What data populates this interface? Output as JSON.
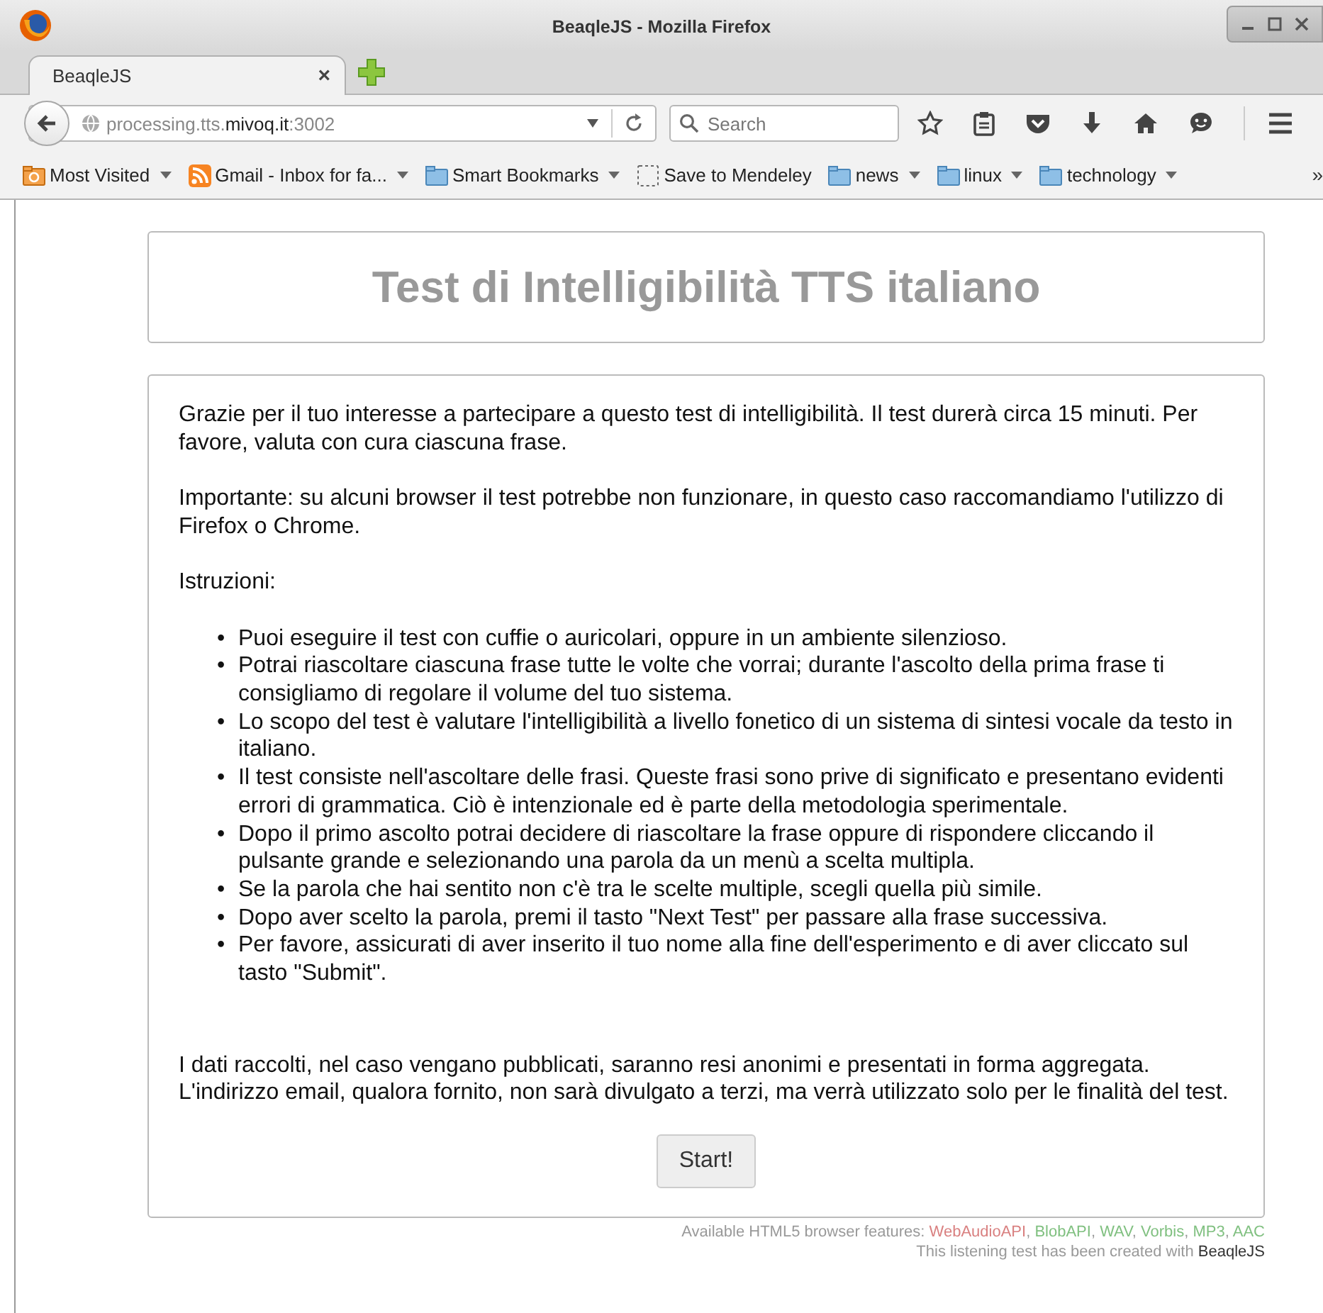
{
  "window": {
    "title": "BeaqleJS - Mozilla Firefox"
  },
  "tabs": [
    {
      "label": "BeaqleJS",
      "selected": true,
      "close": "×"
    }
  ],
  "address_bar": {
    "url_parts": [
      {
        "text": "processing.tts.",
        "emphasis": false
      },
      {
        "text": "mivoq.it",
        "emphasis": true
      },
      {
        "text": ":3002",
        "emphasis": false
      }
    ]
  },
  "search": {
    "placeholder": "Search"
  },
  "bookmarks": [
    {
      "label": "Most Visited",
      "kind": "smart",
      "menu": true
    },
    {
      "label": "Gmail - Inbox for fa...",
      "kind": "feed",
      "menu": true
    },
    {
      "label": "Smart Bookmarks",
      "kind": "folder",
      "menu": true
    },
    {
      "label": "Save to Mendeley",
      "kind": "bookmarklet",
      "menu": false
    },
    {
      "label": "news",
      "kind": "folder",
      "menu": true
    },
    {
      "label": "linux",
      "kind": "folder",
      "menu": true
    },
    {
      "label": "technology",
      "kind": "folder",
      "menu": true
    }
  ],
  "bookmarks_overflow": "»",
  "page": {
    "title": "Test di Intelligibilità TTS italiano",
    "paragraphs": [
      "Grazie per il tuo interesse a partecipare a questo test di intelligibilità. Il test durerà circa 15 minuti. Per favore, valuta con cura ciascuna frase.",
      "Importante: su alcuni browser il test potrebbe non funzionare, in questo caso raccomandiamo l'utilizzo di Firefox o Chrome.",
      "Istruzioni:"
    ],
    "instructions": [
      {
        "marker": "•",
        "text": "Puoi eseguire il test con cuffie o auricolari, oppure in un ambiente silenzioso."
      },
      {
        "marker": "•",
        "text": "Potrai riascoltare ciascuna frase tutte le volte che vorrai; durante l'ascolto della prima frase ti consigliamo di regolare il volume del tuo sistema."
      },
      {
        "marker": "•",
        "text": "Lo scopo del test è valutare l'intelligibilità a livello fonetico di un sistema di sintesi vocale da testo in italiano."
      },
      {
        "marker": "•",
        "text": "Il test consiste nell'ascoltare delle frasi. Queste frasi sono prive di significato e presentano evidenti errori di grammatica. Ciò è intenzionale ed è parte della metodologia sperimentale."
      },
      {
        "marker": "•",
        "text": "Dopo il primo ascolto potrai decidere di riascoltare la frase oppure di rispondere cliccando il pulsante grande e selezionando una parola da un menù a scelta multipla."
      },
      {
        "marker": "•",
        "text": "Se la parola che hai sentito non c'è tra le scelte multiple, scegli quella più simile."
      },
      {
        "marker": "•",
        "text": "Dopo aver scelto la parola, premi il tasto \"Next Test\" per passare alla frase successiva."
      },
      {
        "marker": "•",
        "text": "Per favore, assicurati di aver inserito il tuo nome alla fine dell'esperimento e di aver cliccato sul tasto \"Submit\"."
      }
    ],
    "closing": "I dati raccolti, nel caso vengano pubblicati, saranno resi anonimi e presentati in forma aggregata. L'indirizzo email, qualora fornito, non sarà divulgato a terzi, ma verrà utilizzato solo per le finalità del test.",
    "start_button": "Start!"
  },
  "footer": {
    "features_label": "Available HTML5 browser features:",
    "separator": ", ",
    "features": [
      {
        "name": "WebAudioAPI",
        "color": "#d98080"
      },
      {
        "name": "BlobAPI",
        "color": "#80c080"
      },
      {
        "name": "WAV",
        "color": "#80c080"
      },
      {
        "name": "Vorbis",
        "color": "#80c080"
      },
      {
        "name": "MP3",
        "color": "#80c080"
      },
      {
        "name": "AAC",
        "color": "#80c080"
      }
    ],
    "credit": "This listening test has been created with",
    "credit_link": "BeaqleJS"
  }
}
